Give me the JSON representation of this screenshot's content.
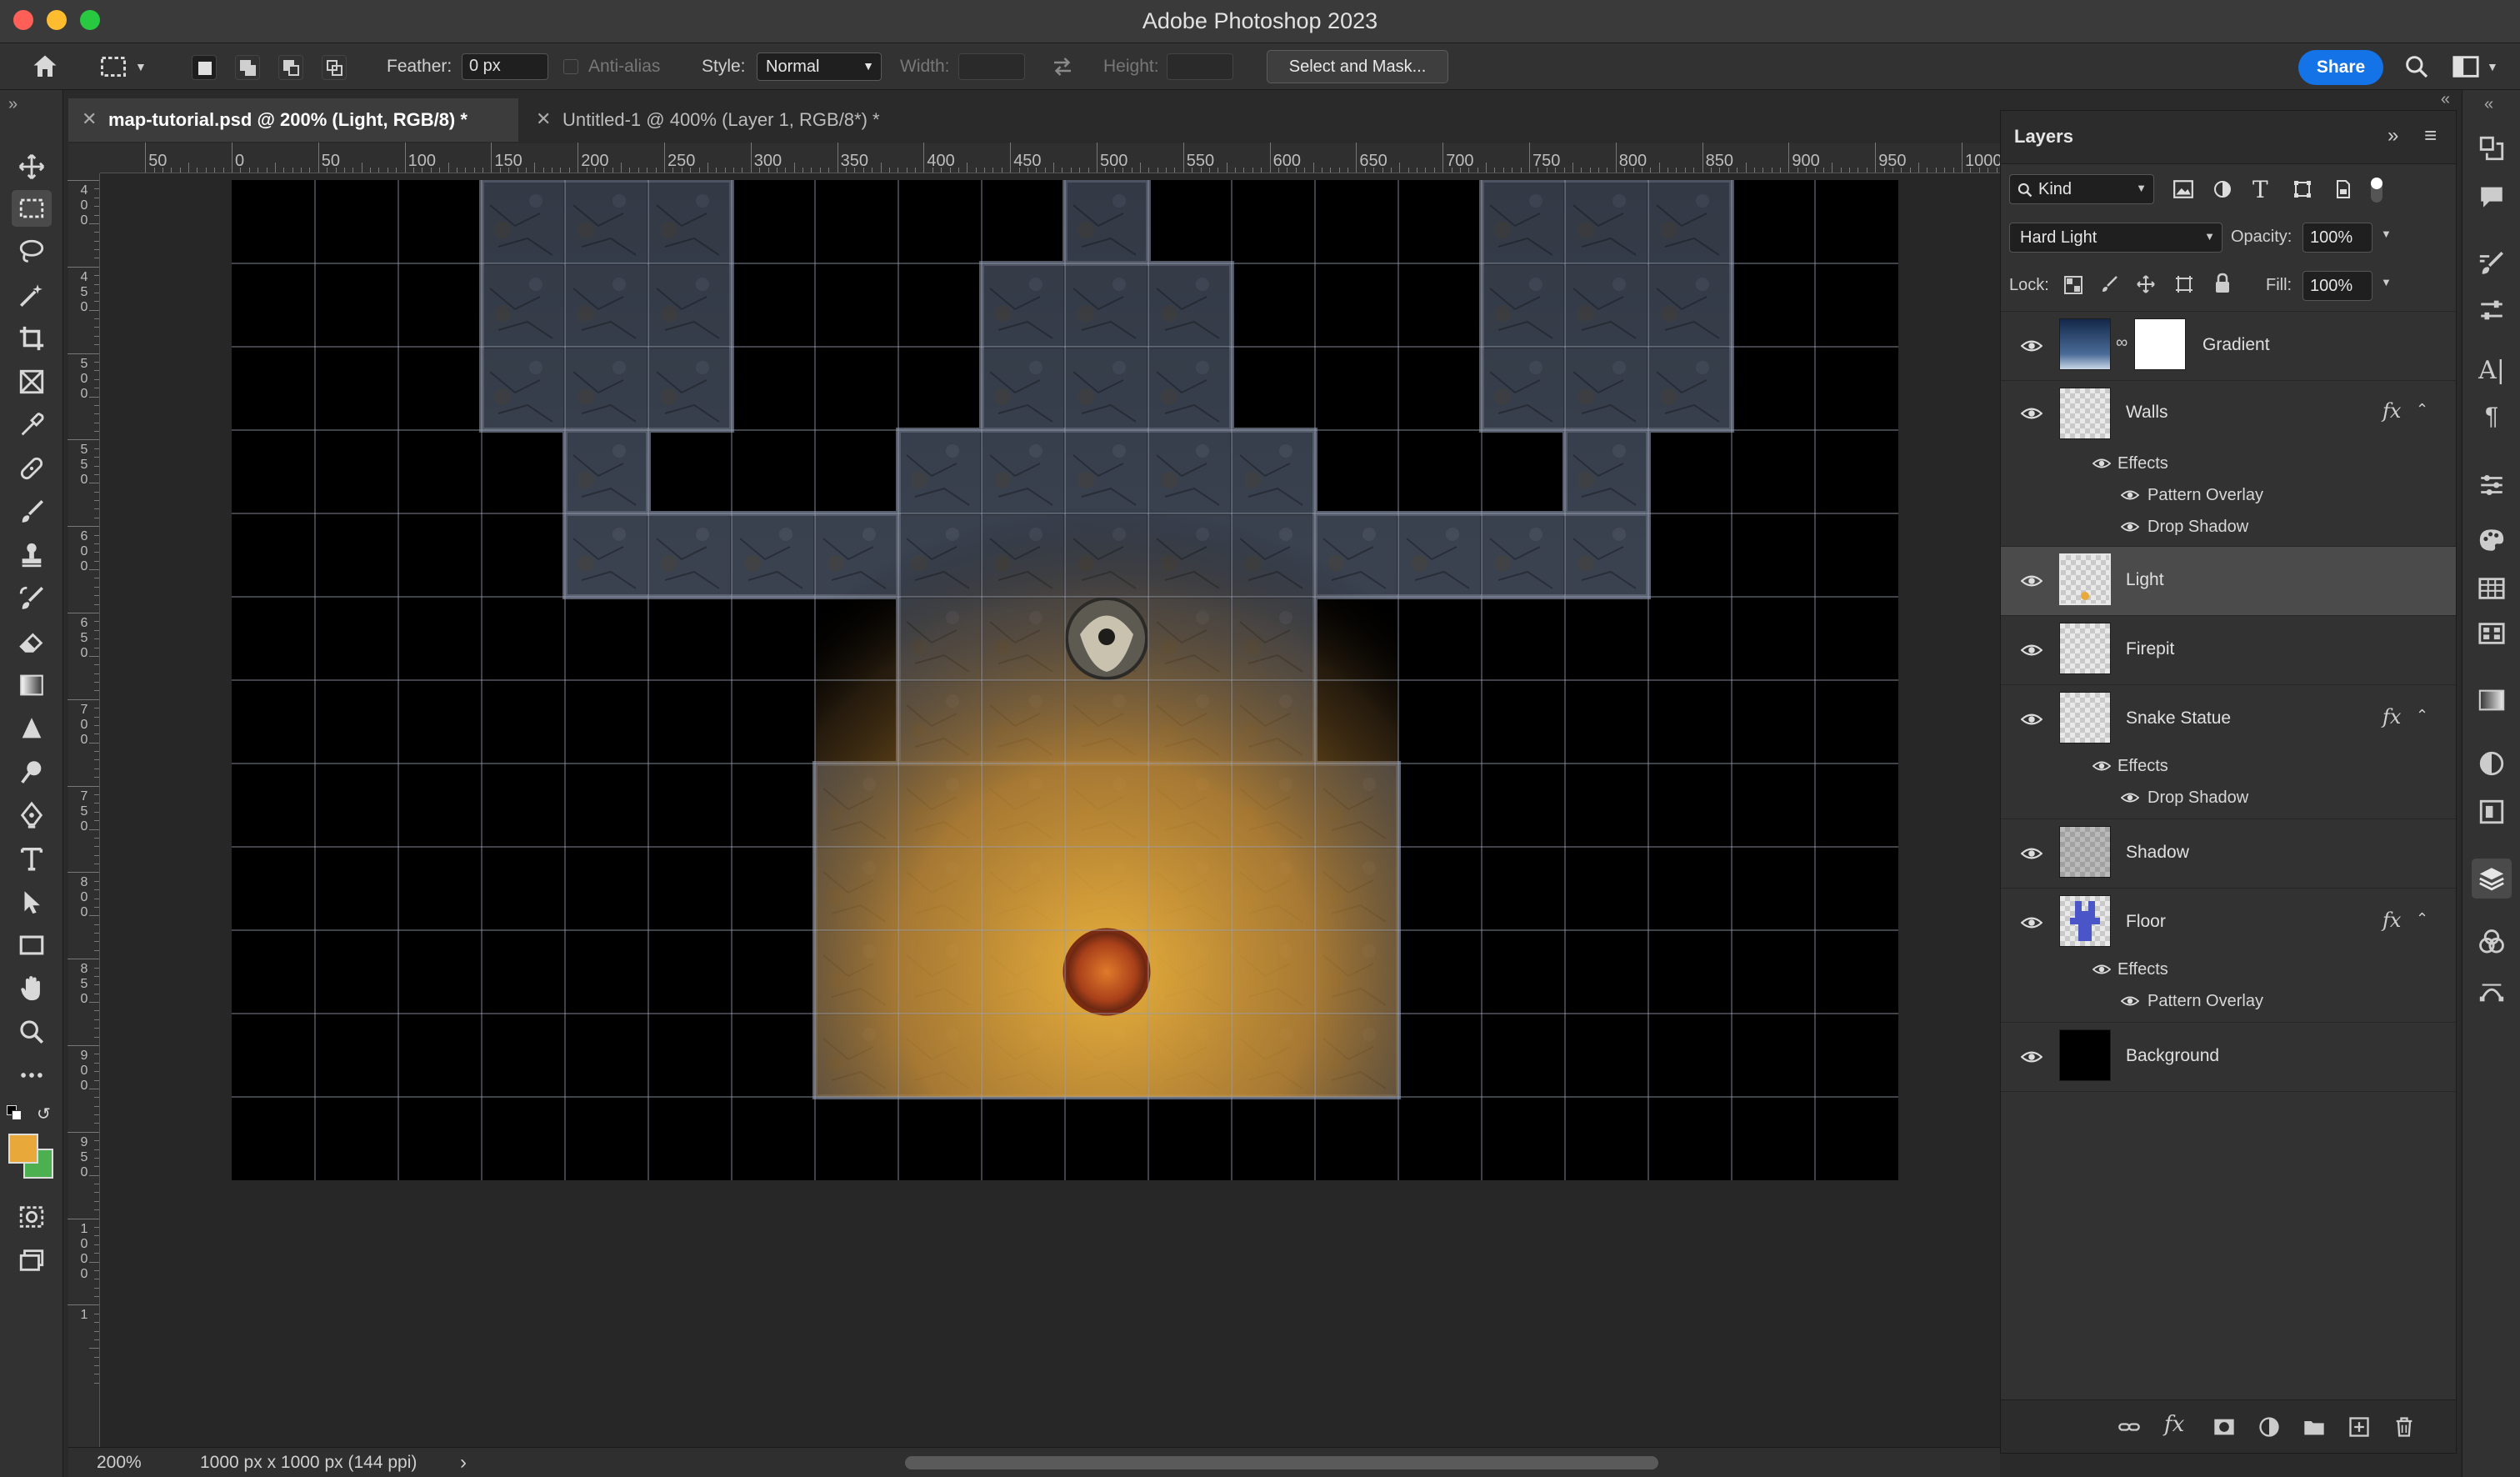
{
  "window": {
    "title": "Adobe Photoshop 2023"
  },
  "options_bar": {
    "feather_label": "Feather:",
    "feather_value": "0 px",
    "antialias_label": "Anti-alias",
    "style_label": "Style:",
    "style_value": "Normal",
    "width_label": "Width:",
    "height_label": "Height:",
    "select_mask_label": "Select and Mask...",
    "share_label": "Share"
  },
  "tabs": [
    {
      "label": "map-tutorial.psd @ 200% (Light, RGB/8) *",
      "active": true
    },
    {
      "label": "Untitled-1 @ 400% (Layer 1, RGB/8*) *",
      "active": false
    }
  ],
  "rulers": {
    "horizontal": [
      "50",
      "0",
      "50",
      "100",
      "150",
      "200",
      "250",
      "300",
      "350",
      "400",
      "450",
      "500",
      "550",
      "600",
      "650",
      "700",
      "750",
      "800",
      "850",
      "900",
      "950",
      "1000",
      "10"
    ],
    "vertical": [
      "400",
      "450",
      "500",
      "550",
      "600",
      "650",
      "700",
      "750",
      "800",
      "850",
      "900",
      "950",
      "1000",
      "1"
    ]
  },
  "status_bar": {
    "zoom": "200%",
    "doc_info": "1000 px x 1000 px (144 ppi)",
    "arrow": "›"
  },
  "colors": {
    "foreground": "#e8a93a",
    "background": "#4caf50",
    "accent": "#1473e6"
  },
  "layers_panel": {
    "title": "Layers",
    "filter_kind": "Kind",
    "blend_mode": "Hard Light",
    "opacity_label": "Opacity:",
    "opacity_value": "100%",
    "lock_label": "Lock:",
    "fill_label": "Fill:",
    "fill_value": "100%",
    "effects_label": "Effects",
    "layers": [
      {
        "name": "Gradient",
        "visible": true,
        "fx": false,
        "thumb": "gradient-with-mask"
      },
      {
        "name": "Walls",
        "visible": true,
        "fx": true,
        "effects": [
          "Pattern Overlay",
          "Drop Shadow"
        ]
      },
      {
        "name": "Light",
        "visible": true,
        "fx": false,
        "selected": true
      },
      {
        "name": "Firepit",
        "visible": true,
        "fx": false
      },
      {
        "name": "Snake Statue",
        "visible": true,
        "fx": true,
        "effects": [
          "Drop Shadow"
        ]
      },
      {
        "name": "Shadow",
        "visible": true,
        "fx": false
      },
      {
        "name": "Floor",
        "visible": true,
        "fx": true,
        "effects": [
          "Pattern Overlay"
        ]
      },
      {
        "name": "Background",
        "visible": true,
        "fx": false
      }
    ]
  }
}
